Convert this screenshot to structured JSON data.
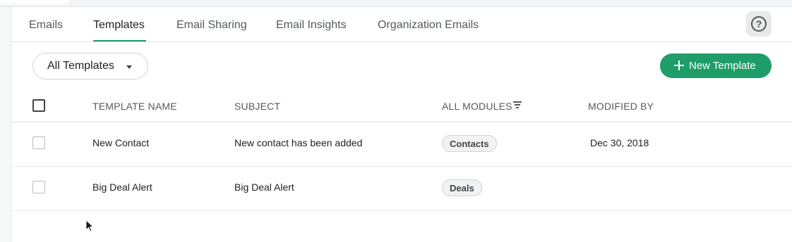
{
  "tabs": [
    {
      "label": "Emails",
      "active": false
    },
    {
      "label": "Templates",
      "active": true
    },
    {
      "label": "Email Sharing",
      "active": false
    },
    {
      "label": "Email Insights",
      "active": false
    },
    {
      "label": "Organization Emails",
      "active": false
    }
  ],
  "help": {
    "icon": "question-circle-icon",
    "glyph": "?"
  },
  "toolbar": {
    "filter_label": "All Templates",
    "new_button_label": "New Template"
  },
  "table": {
    "columns": [
      "TEMPLATE NAME",
      "SUBJECT",
      "ALL MODULES",
      "MODIFIED BY"
    ],
    "rows": [
      {
        "name": "New Contact",
        "subject": "New contact has been added",
        "module": "Contacts",
        "modified": "Dec 30, 2018"
      },
      {
        "name": "Big Deal Alert",
        "subject": "Big Deal Alert",
        "module": "Deals",
        "modified": ""
      }
    ]
  },
  "colors": {
    "accent": "#1f9d68",
    "tab_underline": "#1e9c6a"
  }
}
